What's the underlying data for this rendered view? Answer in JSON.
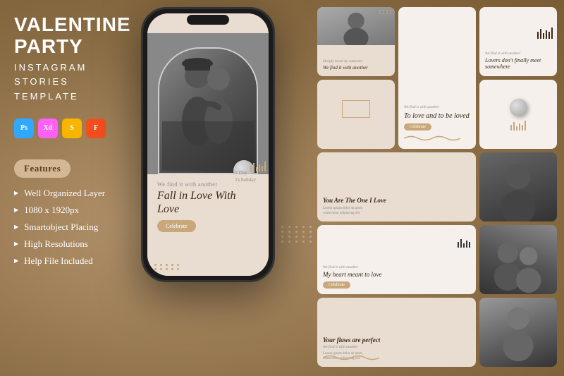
{
  "title": {
    "main": "VALENTINE PARTY",
    "line1": "INSTAGRAM",
    "line2": "STORIES",
    "line3": "TEMPLATE"
  },
  "features": {
    "badge": "Features",
    "items": [
      "Well Organized Layer",
      "1080 x 1920px",
      "Smartobject Placing",
      "High Resolutions",
      "Help File Included"
    ]
  },
  "icons": {
    "ps": "Ps",
    "xd": "Xd",
    "sketch": "S",
    "fig": "F"
  },
  "phone": {
    "subtitle": "We find it with another",
    "title": "Fall in Love With Love",
    "side_text": "'s Day\n't's holiday",
    "cta": "Celebrate"
  },
  "cards": [
    {
      "id": "card1",
      "subtitle": "Deeply loved by someone",
      "title": "We find it with another",
      "type": "top-text-photo"
    },
    {
      "id": "card2",
      "subtitle": "We find it with another",
      "title": "To love and to be loved",
      "cta": "Celebrate",
      "type": "text-cta"
    },
    {
      "id": "card3",
      "subtitle": "We find it with another",
      "title": "Lovers don't finally meet somewhere",
      "type": "text-bars"
    },
    {
      "id": "card4",
      "subtitle": "",
      "title": "",
      "type": "rect-decoration"
    },
    {
      "id": "card5",
      "subtitle": "You Are The One I Love",
      "body": "Lorem ipsum dolor sit amet, consectetur adipiscing elit",
      "type": "text-body"
    },
    {
      "id": "card6",
      "subtitle": "We find it with another",
      "title": "My heart meant to love",
      "cta": "Celebrate",
      "type": "text-cta-bars"
    },
    {
      "id": "card7",
      "title": "Your flaws are perfect",
      "subtitle": "We find it with another",
      "body": "Lorem ipsum dolor sit amet, consectetur adipiscing elit",
      "type": "text-body-wave"
    },
    {
      "id": "card8",
      "type": "photo-dark"
    }
  ]
}
